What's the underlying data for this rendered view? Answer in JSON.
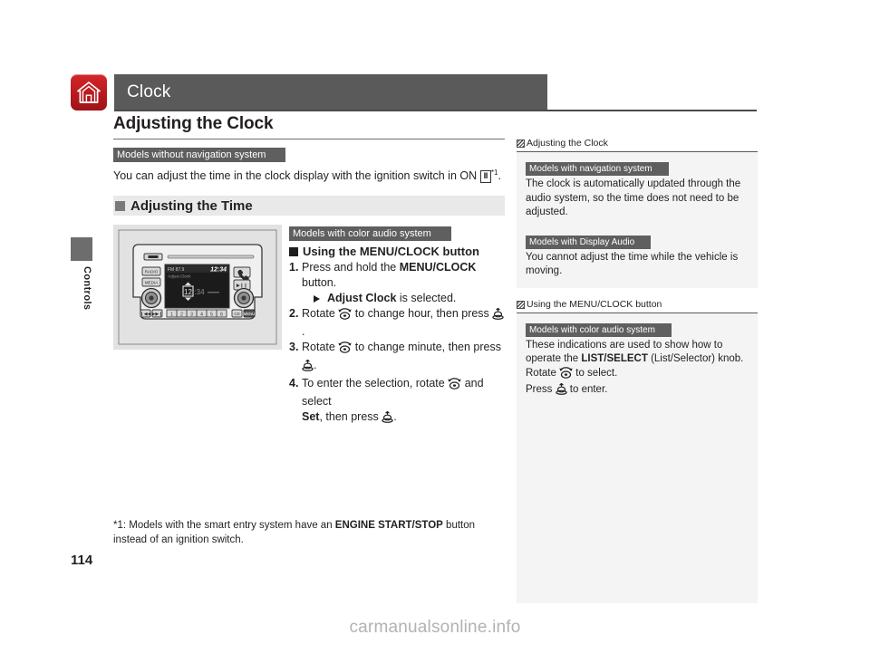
{
  "header": {
    "home_icon": "home-icon",
    "chapter_title": "Clock"
  },
  "side_tab": {
    "label": "Controls"
  },
  "main": {
    "section_title": "Adjusting the Clock",
    "intro_tag": "Models without navigation system",
    "intro_text_before": "You can adjust the time in the clock display with the ignition switch in ON ",
    "ignition_symbol": "II",
    "footnote_marker": "*1",
    "intro_text_after": ".",
    "subsection_title": "Adjusting the Time",
    "figure": {
      "name": "color-audio-unit-illustration",
      "display_time": "12:34",
      "display_label": "Adjust Clock",
      "button_radio": "RADIO",
      "button_media": "MEDIA",
      "preset_numbers": [
        "1",
        "2",
        "3",
        "4",
        "5",
        "6"
      ]
    },
    "steps_tag": "Models with color audio system",
    "steps_heading": "Using the MENU/CLOCK button",
    "steps": [
      {
        "num": "1.",
        "text_parts": [
          "Press and hold the ",
          "MENU/CLOCK",
          " button."
        ],
        "substep_parts": [
          "",
          "Adjust Clock",
          " is selected."
        ]
      },
      {
        "num": "2.",
        "text_parts": [
          "Rotate ",
          "rotate-knob-icon",
          " to change hour, then press ",
          "press-knob-icon",
          "."
        ]
      },
      {
        "num": "3.",
        "text_parts": [
          "Rotate ",
          "rotate-knob-icon",
          " to change minute, then press ",
          "press-knob-icon",
          "."
        ]
      },
      {
        "num": "4.",
        "text_parts": [
          "To enter the selection, rotate ",
          "rotate-knob-icon",
          " and select ",
          "Set",
          ", then press ",
          "press-knob-icon",
          "."
        ]
      }
    ]
  },
  "footnote": {
    "prefix": "*1: Models with the smart entry system have an ",
    "bold": "ENGINE START/STOP",
    "suffix": " button instead of an ignition switch."
  },
  "folio": {
    "page_number": "114"
  },
  "sidebar": {
    "head_1": "Adjusting the Clock",
    "panel_1": {
      "tag_1": "Models with navigation system",
      "text_1": "The clock is automatically updated through the audio system, so the time does not need to be adjusted.",
      "tag_2": "Models with Display Audio",
      "text_2": "You cannot adjust the time while the vehicle is moving."
    },
    "head_2": "Using the MENU/CLOCK button",
    "panel_2": {
      "tag_1": "Models with color audio system",
      "text_before_bold": "These indications are used to show how to operate the ",
      "bold": "LIST/SELECT",
      "text_after_bold": " (List/Selector) knob.",
      "rotate_line_before": "Rotate ",
      "rotate_line_after": " to select.",
      "press_line_before": "Press ",
      "press_line_after": " to enter."
    }
  },
  "watermark": {
    "text": "carmanualsonline.info"
  },
  "colors": {
    "chapter_bar": "#5a5a5a",
    "home_icon_red": "#b81b20",
    "tag_gray": "#5f5f5f",
    "band_gray": "#e9e9e9",
    "sidebar_panel": "#f4f4f4",
    "figure_bg": "#e2e2e2"
  }
}
